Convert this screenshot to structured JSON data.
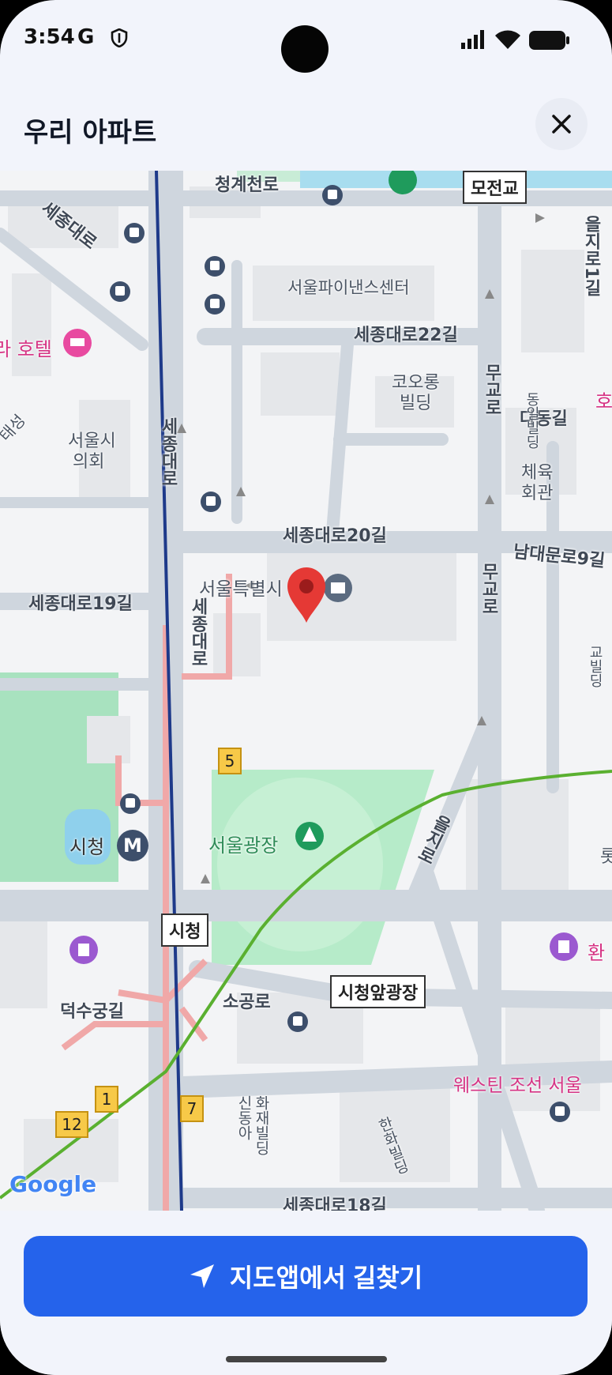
{
  "status": {
    "time": "3:54",
    "g": "G"
  },
  "header": {
    "title": "우리 아파트"
  },
  "map": {
    "labels": {
      "cheonggye": "청계천로",
      "mojeongyo": "모전교",
      "sejongdaero_nw": "세종대로",
      "finance_center": "서울파이낸스센터",
      "sejongdaero22": "세종대로22길",
      "hotel_left": "라 호텔",
      "kolon1": "코오롱",
      "kolon2": "빌딩",
      "mugyoro_top": "무교로",
      "dadonggil": "다동길",
      "seoul_council1": "서울시",
      "seoul_council2": "의회",
      "taeseong": "태성",
      "sejongdaero_v": "세종대로",
      "gym1": "체육",
      "gym2": "회관",
      "dong_il": "동일빌딩",
      "eulji1": "을지로1길",
      "ho_right": "호",
      "sejongdaero20": "세종대로20길",
      "namdaemun9": "남대문로9길",
      "sejongdaero19": "세종대로19길",
      "city_hall_bldg": "서울특별시",
      "sejongdaero_v2": "세종대로",
      "mugyoro2": "무교로",
      "seoul_plaza": "서울광장",
      "cityhall": "시청",
      "cityhall_box": "시청",
      "euljiro": "을지로",
      "deoksugung": "덕수궁길",
      "sogongro": "소공로",
      "plaza_front": "시청앞광장",
      "westin": "웨스틴 조선 서울",
      "hwan": "환",
      "lot": "롯",
      "sindonga1": "신동아",
      "sindonga2": "화재빌딩",
      "hanwha": "한화빌딩",
      "sejongdaero18": "세종대로18길",
      "ulji_right": "을지로",
      "sewoon": "교빌딩",
      "google": "Google"
    },
    "exits": [
      "5",
      "1",
      "12",
      "7"
    ],
    "metro": "M"
  },
  "cta": {
    "label": "지도앱에서 길찾기"
  }
}
